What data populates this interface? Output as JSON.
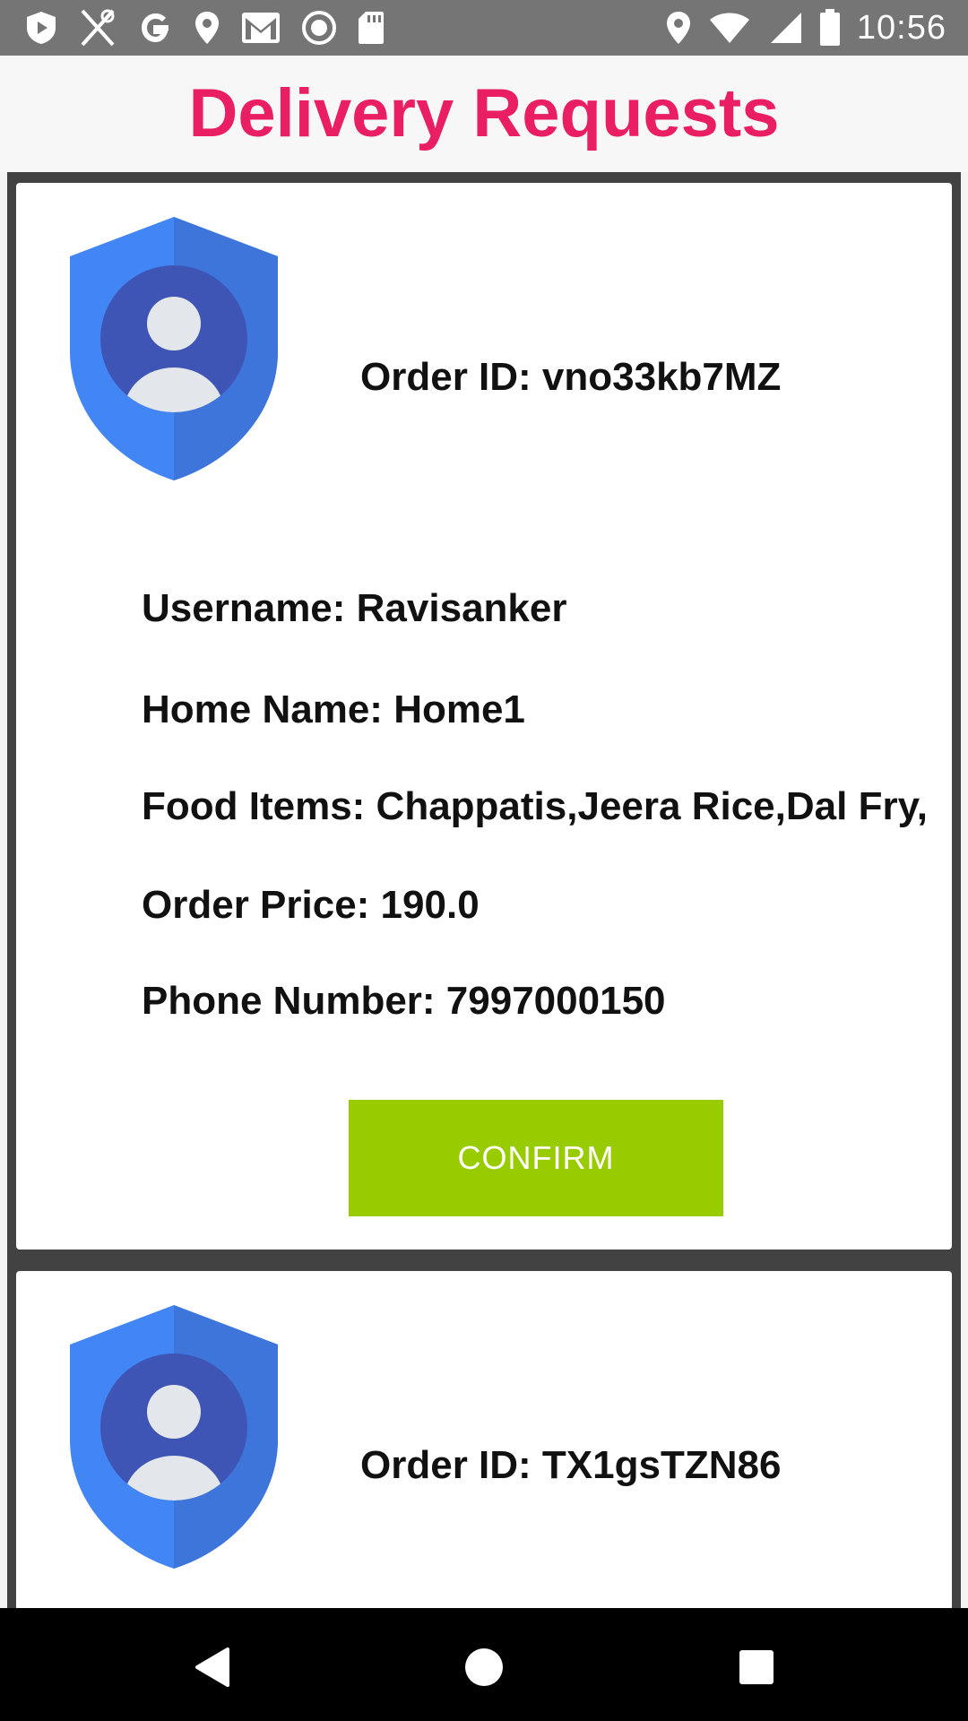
{
  "status_bar": {
    "time": "10:56",
    "left_icons": [
      "play-store-icon",
      "restaurant-icon",
      "google-icon",
      "location-icon",
      "gmail-icon",
      "record-icon",
      "sd-card-icon"
    ],
    "right_icons": [
      "location-icon",
      "wifi-icon",
      "signal-icon",
      "battery-icon"
    ]
  },
  "header": {
    "title": "Delivery Requests",
    "title_color": "#e91e63"
  },
  "orders": [
    {
      "order_id": "Order ID: vno33kb7MZ",
      "username": "Username: Ravisanker",
      "home_name": "Home Name: Home1",
      "food_items": "Food Items: Chappatis,Jeera Rice,Dal Fry,",
      "order_price": "Order Price: 190.0",
      "phone_number": "Phone Number: 7997000150",
      "confirm_label": "CONFIRM"
    },
    {
      "order_id": "Order ID: TX1gsTZN86"
    }
  ],
  "colors": {
    "confirm": "#99cc00",
    "list_background": "#424242",
    "shield_light": "#4285f4",
    "shield_dark": "#3c6fd9"
  },
  "nav_bar": {
    "icons": [
      "back-icon",
      "home-icon",
      "recent-apps-icon"
    ]
  }
}
